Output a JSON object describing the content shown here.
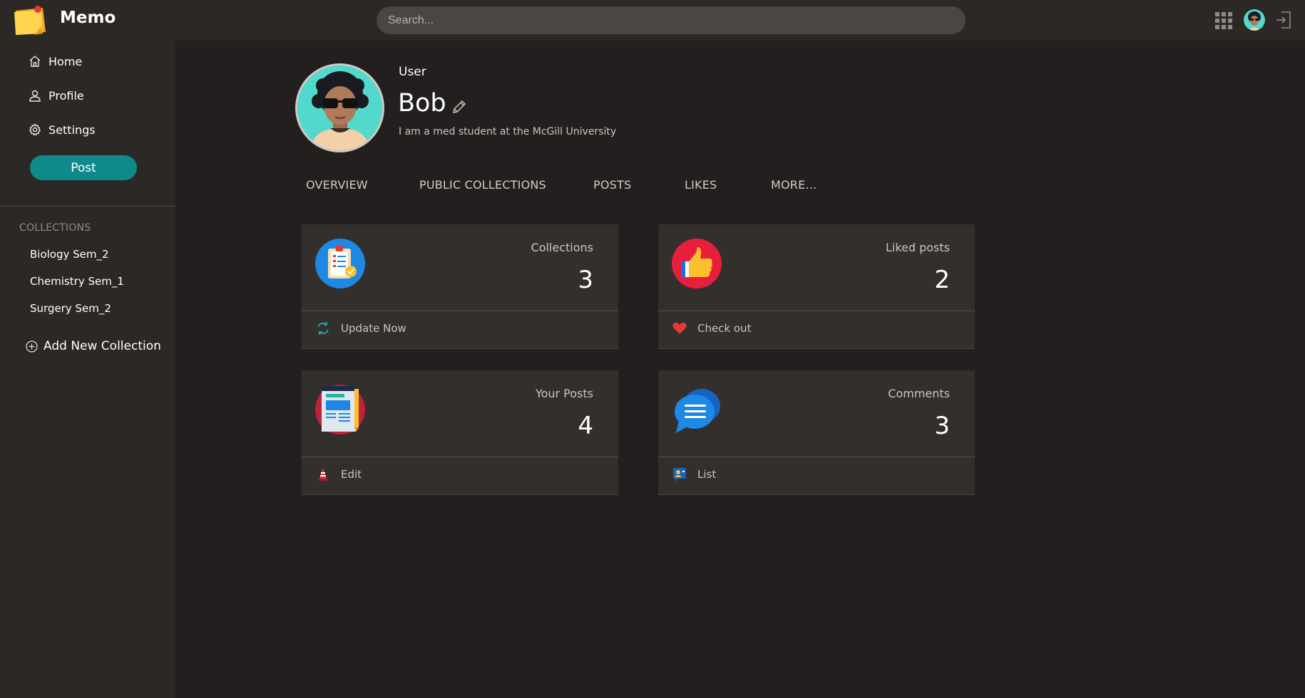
{
  "app": {
    "brand": "Memo"
  },
  "search": {
    "placeholder": "Search..."
  },
  "sidebar": {
    "nav": [
      {
        "label": "Home",
        "icon": "home-icon"
      },
      {
        "label": "Profile",
        "icon": "user-icon"
      },
      {
        "label": "Settings",
        "icon": "gear-icon"
      }
    ],
    "post_label": "Post",
    "collections_heading": "COLLECTIONS",
    "collections": [
      "Biology Sem_2",
      "Chemistry Sem_1",
      "Surgery Sem_2"
    ],
    "add_collection_label": "Add New Collection"
  },
  "profile": {
    "role": "User",
    "name": "Bob",
    "bio": "I am a med student at the McGill University"
  },
  "tabs": [
    "OVERVIEW",
    "PUBLIC COLLECTIONS",
    "POSTS",
    "LIKES",
    "MORE..."
  ],
  "cards": [
    {
      "label": "Collections",
      "value": "3",
      "footer": "Update Now",
      "icon": "clipboard-icon",
      "footer_icon": "refresh-icon"
    },
    {
      "label": "Liked posts",
      "value": "2",
      "footer": "Check out",
      "icon": "thumbs-up-icon",
      "footer_icon": "heart-icon"
    },
    {
      "label": "Your Posts",
      "value": "4",
      "footer": "Edit",
      "icon": "newspaper-icon",
      "footer_icon": "cone-icon"
    },
    {
      "label": "Comments",
      "value": "3",
      "footer": "List",
      "icon": "chat-bubbles-icon",
      "footer_icon": "user-list-icon"
    }
  ],
  "colors": {
    "background": "#231f1e",
    "panel": "#2c2826",
    "card": "#332f2d",
    "accent": "#0f8a8a",
    "heart": "#e53935",
    "avatar_bg": "#53d8cc"
  }
}
